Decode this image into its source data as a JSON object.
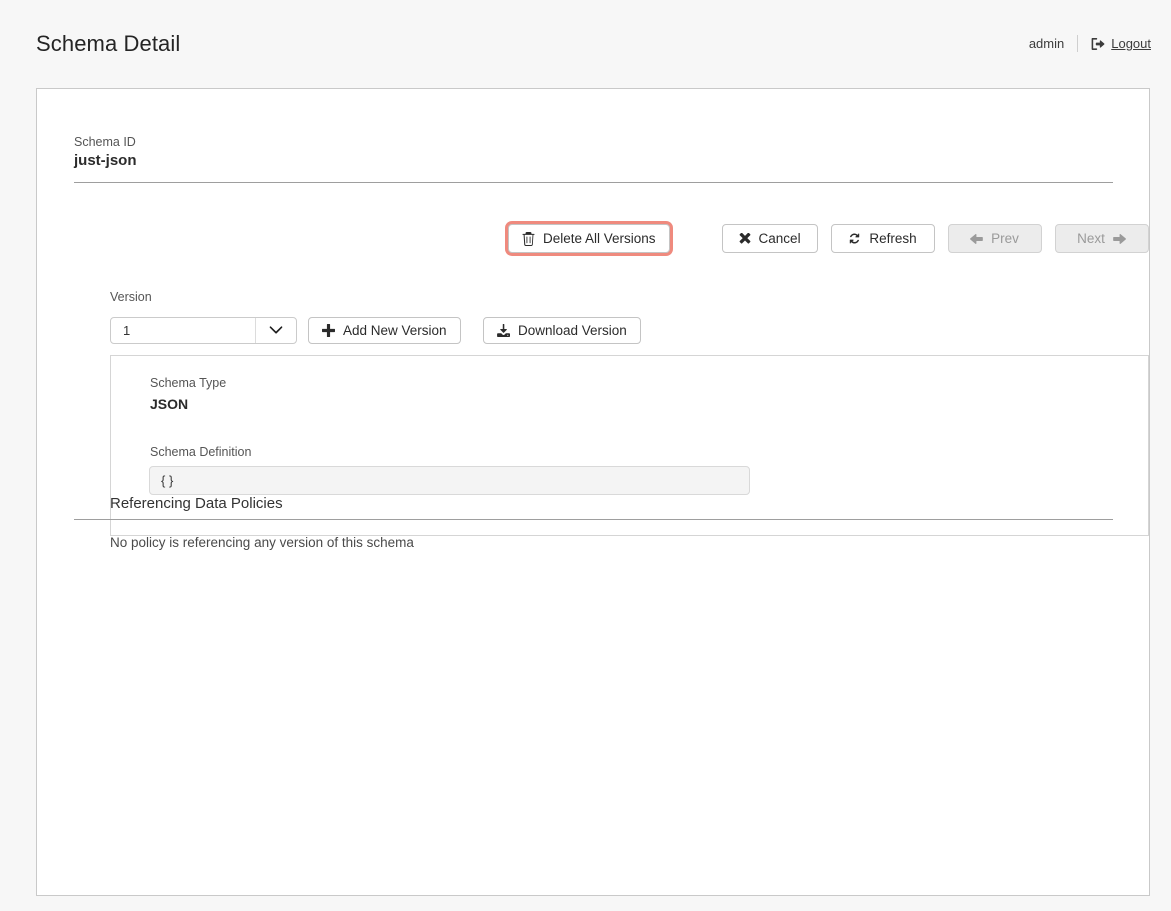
{
  "header": {
    "title": "Schema Detail",
    "user": "admin",
    "logout_label": "Logout",
    "logout_icon": "sign-out-icon"
  },
  "schema": {
    "id_label": "Schema ID",
    "id_value": "just-json",
    "version_label": "Version",
    "version_value": "1",
    "type_label": "Schema Type",
    "type_value": "JSON",
    "definition_label": "Schema Definition",
    "definition_value": "{ }"
  },
  "toolbar": {
    "delete_all_label": "Delete All Versions",
    "delete_all_icon": "trash-icon",
    "cancel_label": "Cancel",
    "cancel_icon": "close-icon",
    "refresh_label": "Refresh",
    "refresh_icon": "refresh-icon",
    "prev_label": "Prev",
    "prev_icon": "arrow-left-icon",
    "next_label": "Next",
    "next_icon": "arrow-right-icon"
  },
  "version_actions": {
    "add_label": "Add New Version",
    "add_icon": "plus-icon",
    "download_label": "Download Version",
    "download_icon": "download-icon",
    "caret_icon": "chevron-down-icon"
  },
  "policies": {
    "title": "Referencing Data Policies",
    "empty_message": "No policy is referencing any version of this schema"
  },
  "colors": {
    "page_background": "#f7f7f7",
    "card_background": "#ffffff",
    "card_border": "#c9c9c9",
    "danger_focus": "#ef8a7e",
    "text_primary": "#333333",
    "text_muted": "#555555",
    "disabled_background": "#ececec",
    "disabled_text": "#9a9a9a"
  }
}
